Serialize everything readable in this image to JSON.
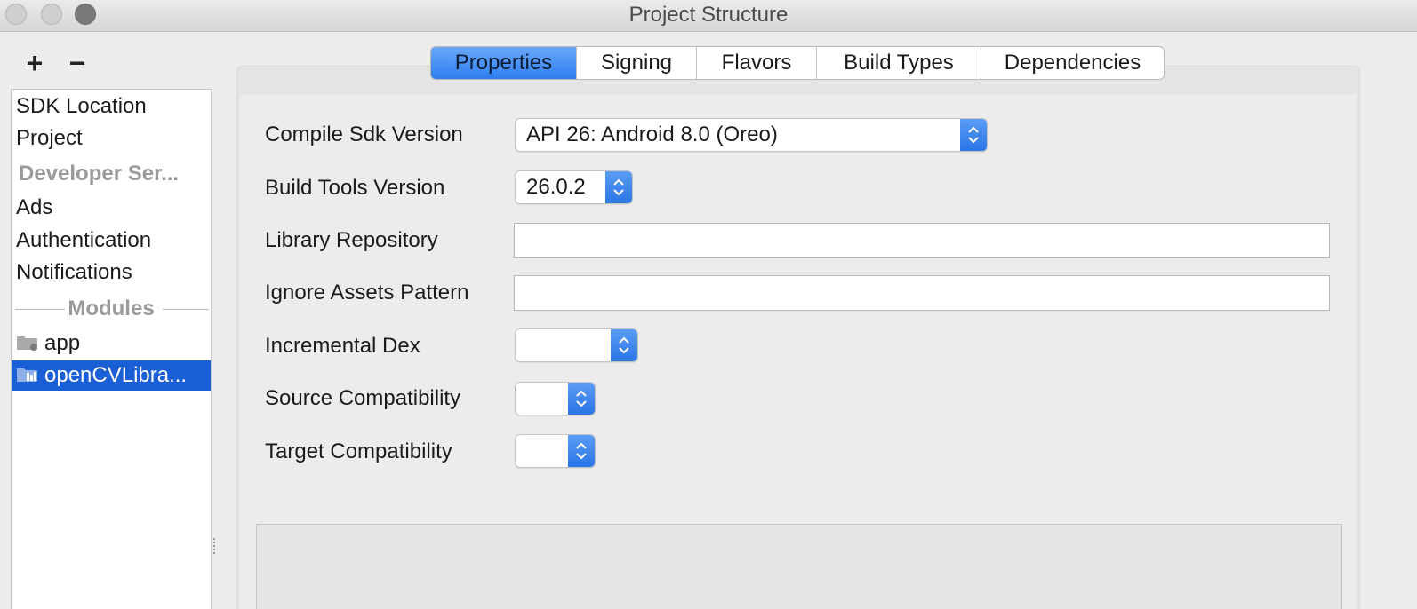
{
  "window": {
    "title": "Project Structure"
  },
  "toolbar": {
    "add_icon": "+",
    "remove_icon": "−"
  },
  "sidebar": {
    "items": [
      {
        "label": "SDK Location"
      },
      {
        "label": "Project"
      },
      {
        "label": "Developer Ser..."
      },
      {
        "label": "Ads"
      },
      {
        "label": "Authentication"
      },
      {
        "label": "Notifications"
      }
    ],
    "modules_header": "Modules",
    "modules": [
      {
        "label": "app",
        "icon": "module-folder-icon"
      },
      {
        "label": "openCVLibra...",
        "icon": "library-module-icon",
        "selected": true
      }
    ]
  },
  "tabs": [
    {
      "label": "Properties",
      "active": true
    },
    {
      "label": "Signing"
    },
    {
      "label": "Flavors"
    },
    {
      "label": "Build Types"
    },
    {
      "label": "Dependencies"
    }
  ],
  "properties": {
    "compile_sdk": {
      "label": "Compile Sdk Version",
      "value": "API 26: Android 8.0 (Oreo)"
    },
    "build_tools": {
      "label": "Build Tools Version",
      "value": "26.0.2"
    },
    "library_repository": {
      "label": "Library Repository",
      "value": ""
    },
    "ignore_assets": {
      "label": "Ignore Assets Pattern",
      "value": ""
    },
    "incremental_dex": {
      "label": "Incremental Dex",
      "value": ""
    },
    "source_compat": {
      "label": "Source Compatibility",
      "value": ""
    },
    "target_compat": {
      "label": "Target Compatibility",
      "value": ""
    }
  },
  "colors": {
    "accent": "#2e7ef0",
    "selection": "#1b5fd6"
  }
}
